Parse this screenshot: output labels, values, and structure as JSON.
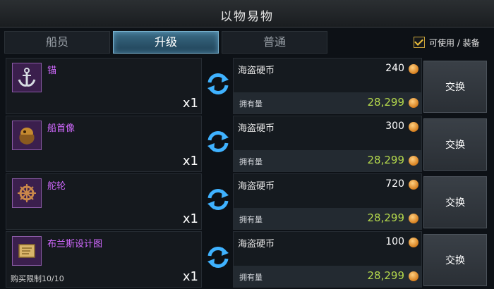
{
  "window": {
    "title": "以物易物"
  },
  "tabs": [
    {
      "label": "船员",
      "active": false
    },
    {
      "label": "升级",
      "active": true
    },
    {
      "label": "普通",
      "active": false
    }
  ],
  "filter": {
    "label": "可使用 / 装备",
    "checked": true
  },
  "colors": {
    "item_name": "#d169ff",
    "owned_value": "#b4d84c",
    "active_tab": "#3b6c86"
  },
  "items": [
    {
      "name": "锚",
      "icon": "anchor-icon",
      "quantity": "x1",
      "currency": "海盗硬币",
      "price": "240",
      "owned_label": "拥有量",
      "owned": "28,299",
      "button": "交换",
      "limit": ""
    },
    {
      "name": "船首像",
      "icon": "figurehead-icon",
      "quantity": "x1",
      "currency": "海盗硬币",
      "price": "300",
      "owned_label": "拥有量",
      "owned": "28,299",
      "button": "交换",
      "limit": ""
    },
    {
      "name": "舵轮",
      "icon": "ship-wheel-icon",
      "quantity": "x1",
      "currency": "海盗硬币",
      "price": "720",
      "owned_label": "拥有量",
      "owned": "28,299",
      "button": "交换",
      "limit": ""
    },
    {
      "name": "布兰斯设计图",
      "icon": "blueprint-icon",
      "quantity": "x1",
      "currency": "海盗硬币",
      "price": "100",
      "owned_label": "拥有量",
      "owned": "28,299",
      "button": "交换",
      "limit": "购买限制10/10"
    }
  ]
}
